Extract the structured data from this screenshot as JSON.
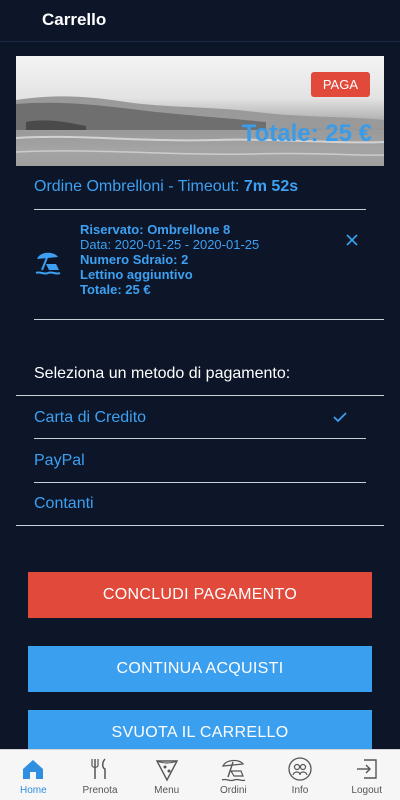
{
  "header": {
    "title": "Carrello"
  },
  "hero": {
    "pay_label": "PAGA",
    "total": "Totale: 25 €"
  },
  "order": {
    "title_prefix": "Ordine Ombrelloni - Timeout: ",
    "timeout": "7m 52s"
  },
  "reservation": {
    "line1": "Riservato: Ombrellone 8",
    "line2": "Data: 2020-01-25 - 2020-01-25",
    "line3": "Numero Sdraio: 2",
    "line4": "Lettino aggiuntivo",
    "line5": "Totale: 25 €"
  },
  "payment": {
    "title": "Seleziona un metodo di pagamento:",
    "methods": [
      "Carta di Credito",
      "PayPal",
      "Contanti"
    ],
    "selected": "Carta di Credito"
  },
  "buttons": {
    "conclude": "CONCLUDI PAGAMENTO",
    "continue": "CONTINUA ACQUISTI",
    "empty": "SVUOTA IL CARRELLO"
  },
  "tabs": [
    "Home",
    "Prenota",
    "Menu",
    "Ordini",
    "Info",
    "Logout"
  ],
  "colors": {
    "background": "#0c1628",
    "accent_blue": "#3ea0f2",
    "accent_red": "#e1493b",
    "tab_active": "#2f8fe0"
  }
}
